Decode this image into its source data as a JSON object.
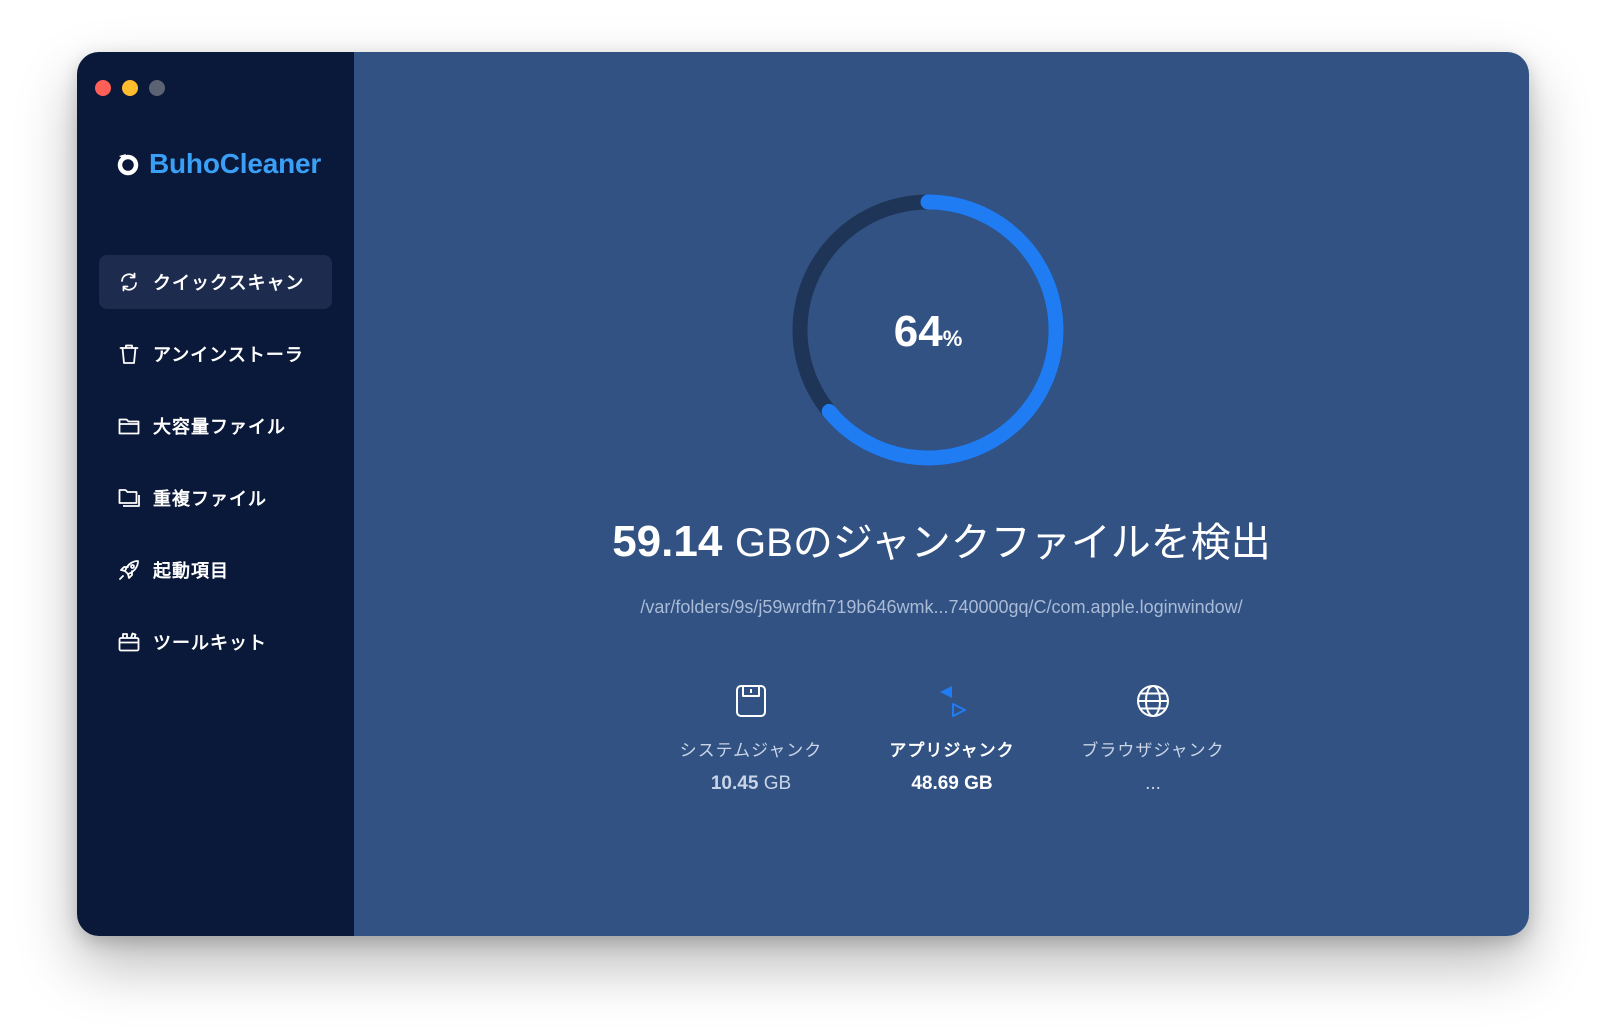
{
  "app": {
    "name": "BuhoCleaner"
  },
  "sidebar": {
    "items": [
      {
        "label": "クイックスキャン",
        "icon": "refresh-icon",
        "active": true
      },
      {
        "label": "アンインストーラ",
        "icon": "trash-icon"
      },
      {
        "label": "大容量ファイル",
        "icon": "folder-icon"
      },
      {
        "label": "重複ファイル",
        "icon": "duplicate-folder-icon"
      },
      {
        "label": "起動項目",
        "icon": "rocket-icon"
      },
      {
        "label": "ツールキット",
        "icon": "toolbox-icon"
      }
    ]
  },
  "scan": {
    "progress_value": "64",
    "progress_unit": "%",
    "progress_fraction": 0.64,
    "found_amount": "59.14",
    "found_unit": "GB",
    "found_text": "のジャンクファイルを検出",
    "current_path": "/var/folders/9s/j59wrdfn719b646wmk...740000gq/C/com.apple.loginwindow/"
  },
  "categories": [
    {
      "label": "システムジャンク",
      "value": "10.45",
      "unit": "GB",
      "icon": "disk-icon"
    },
    {
      "label": "アプリジャンク",
      "value": "48.69",
      "unit": "GB",
      "icon": "app-junk-icon",
      "active": true
    },
    {
      "label": "ブラウザジャンク",
      "value": "...",
      "unit": "",
      "icon": "globe-icon"
    }
  ],
  "colors": {
    "sidebar_bg": "#0a1839",
    "main_bg": "#325283",
    "accent": "#1f7cf2",
    "brand": "#3aa0f7",
    "ring_track": "#1f3558"
  }
}
